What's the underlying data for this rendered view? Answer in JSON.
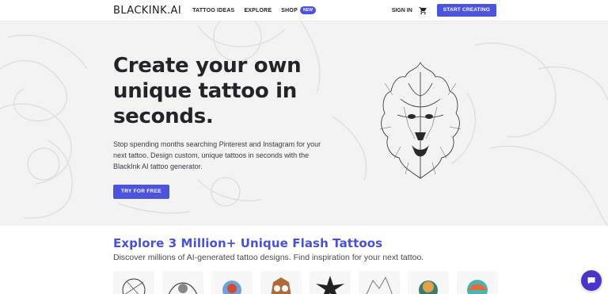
{
  "header": {
    "logo_bold": "BLACKINK",
    "logo_rest": ".AI",
    "nav": [
      {
        "label": "TATTOO IDEAS"
      },
      {
        "label": "EXPLORE"
      },
      {
        "label": "SHOP"
      }
    ],
    "shop_badge": "NEW",
    "sign_in": "SIGN IN",
    "cta": "START CREATING"
  },
  "hero": {
    "title_lines": [
      "Create your own",
      "unique tattoo in",
      "seconds."
    ],
    "description": "Stop spending months searching Pinterest and Instagram for your next tattoo. Design custom, unique tattoos in seconds with the BlackInk AI tattoo generator.",
    "button": "TRY FOR FREE"
  },
  "explore": {
    "title": "Explore 3 Million+ Unique Flash Tattoos",
    "subtitle": "Discover millions of AI-generated tattoo designs. Find inspiration for your next tattoo."
  },
  "icons": {
    "cart": "cart-icon",
    "chat": "chat-bubble-icon",
    "lion": "lion-tattoo-illustration"
  },
  "colors": {
    "accent": "#4c53de",
    "explore_title": "#4a51d6",
    "hero_bg": "#f3f3f4",
    "chat": "#4b34c8"
  }
}
